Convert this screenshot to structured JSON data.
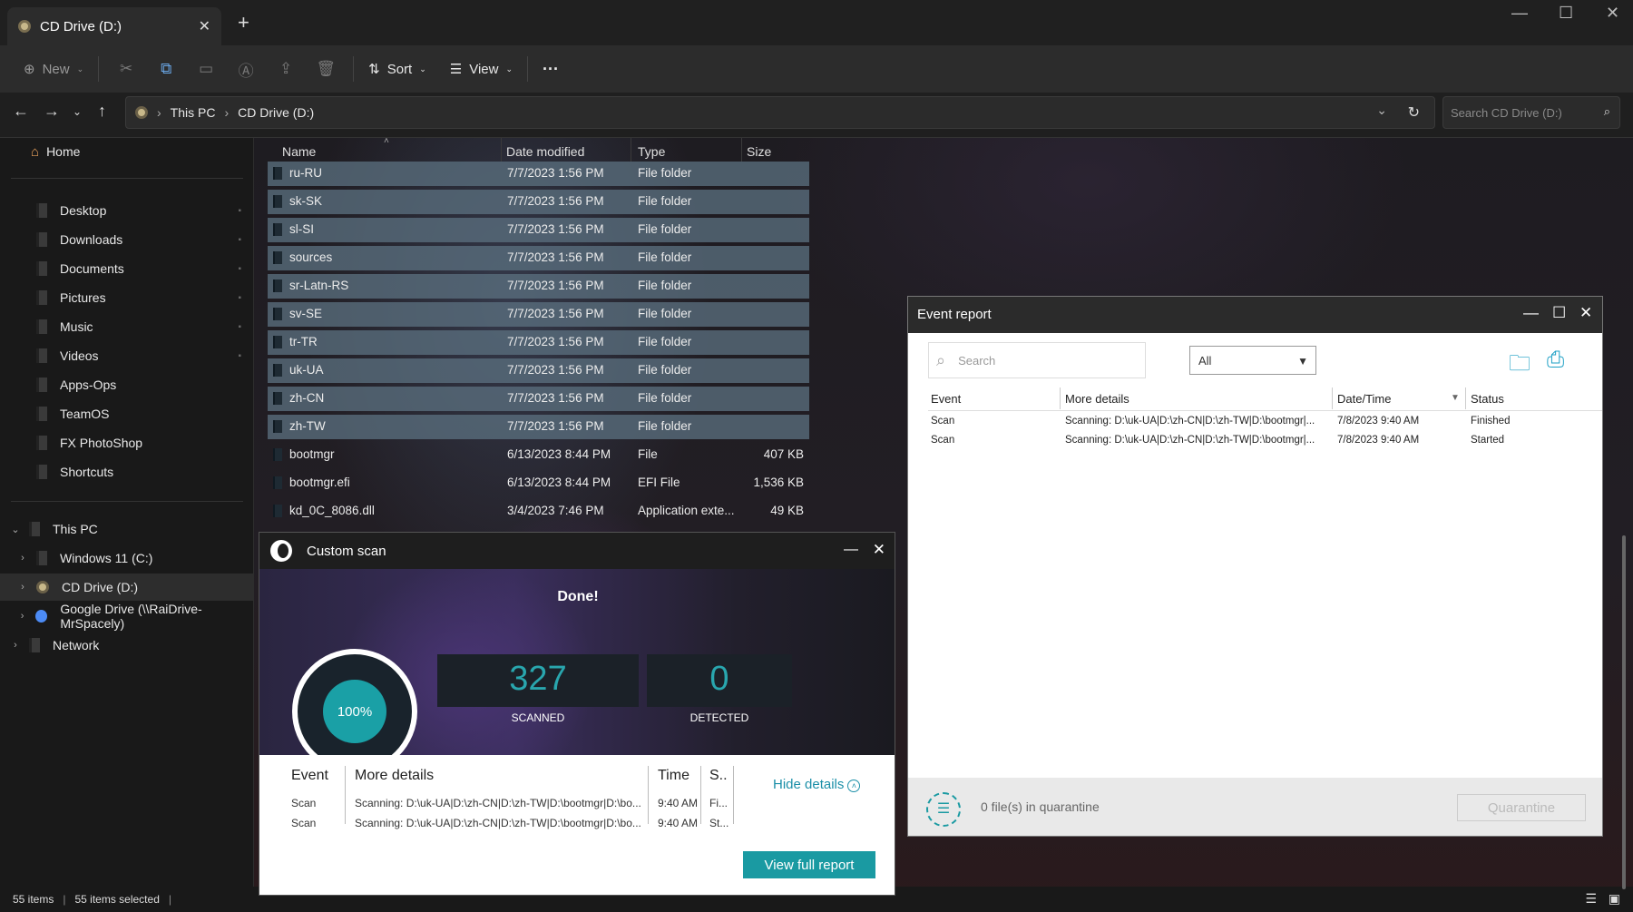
{
  "explorer": {
    "tab_title": "CD Drive (D:)",
    "toolbar": {
      "new_label": "New",
      "sort_label": "Sort",
      "view_label": "View",
      "more_label": "···"
    },
    "breadcrumb": [
      "This PC",
      "CD Drive (D:)"
    ],
    "search_placeholder": "Search CD Drive (D:)",
    "sidebar": {
      "home": "Home",
      "quick_access": [
        "Desktop",
        "Downloads",
        "Documents",
        "Pictures",
        "Music",
        "Videos",
        "Apps-Ops",
        "TeamOS",
        "FX PhotoShop",
        "Shortcuts"
      ],
      "this_pc": "This PC",
      "drives": [
        "Windows 11 (C:)",
        "CD Drive (D:)",
        "Google Drive (\\\\RaiDrive-MrSpacely)"
      ],
      "network": "Network"
    },
    "columns": {
      "name": "Name",
      "date": "Date modified",
      "type": "Type",
      "size": "Size"
    },
    "files": [
      {
        "name": "ru-RU",
        "date": "7/7/2023 1:56 PM",
        "type": "File folder",
        "size": ""
      },
      {
        "name": "sk-SK",
        "date": "7/7/2023 1:56 PM",
        "type": "File folder",
        "size": ""
      },
      {
        "name": "sl-SI",
        "date": "7/7/2023 1:56 PM",
        "type": "File folder",
        "size": ""
      },
      {
        "name": "sources",
        "date": "7/7/2023 1:56 PM",
        "type": "File folder",
        "size": ""
      },
      {
        "name": "sr-Latn-RS",
        "date": "7/7/2023 1:56 PM",
        "type": "File folder",
        "size": ""
      },
      {
        "name": "sv-SE",
        "date": "7/7/2023 1:56 PM",
        "type": "File folder",
        "size": ""
      },
      {
        "name": "tr-TR",
        "date": "7/7/2023 1:56 PM",
        "type": "File folder",
        "size": ""
      },
      {
        "name": "uk-UA",
        "date": "7/7/2023 1:56 PM",
        "type": "File folder",
        "size": ""
      },
      {
        "name": "zh-CN",
        "date": "7/7/2023 1:56 PM",
        "type": "File folder",
        "size": ""
      },
      {
        "name": "zh-TW",
        "date": "7/7/2023 1:56 PM",
        "type": "File folder",
        "size": ""
      },
      {
        "name": "bootmgr",
        "date": "6/13/2023 8:44 PM",
        "type": "File",
        "size": "407 KB"
      },
      {
        "name": "bootmgr.efi",
        "date": "6/13/2023 8:44 PM",
        "type": "EFI File",
        "size": "1,536 KB"
      },
      {
        "name": "kd_0C_8086.dll",
        "date": "3/4/2023 7:46 PM",
        "type": "Application exte...",
        "size": "49 KB"
      }
    ],
    "status": {
      "items": "55 items",
      "selected": "55 items selected"
    }
  },
  "custom_scan": {
    "title": "Custom scan",
    "headline": "Done!",
    "progress_label": "100%",
    "progress": 1.0,
    "scanned": {
      "value": "327",
      "label": "SCANNED"
    },
    "detected": {
      "value": "0",
      "label": "DETECTED"
    },
    "details": {
      "headers": {
        "event": "Event",
        "more": "More details",
        "time": "Time",
        "status": "S.."
      },
      "rows": [
        {
          "event": "Scan",
          "more": "Scanning: D:\\uk-UA|D:\\zh-CN|D:\\zh-TW|D:\\bootmgr|D:\\bo...",
          "time": "9:40 AM",
          "status": "Fi..."
        },
        {
          "event": "Scan",
          "more": "Scanning: D:\\uk-UA|D:\\zh-CN|D:\\zh-TW|D:\\bootmgr|D:\\bo...",
          "time": "9:40 AM",
          "status": "St..."
        }
      ]
    },
    "hide_details": "Hide details",
    "view_report": "View full report"
  },
  "event_report": {
    "title": "Event report",
    "search_placeholder": "Search",
    "filter_value": "All",
    "headers": {
      "event": "Event",
      "more": "More details",
      "datetime": "Date/Time",
      "status": "Status"
    },
    "rows": [
      {
        "event": "Scan",
        "more": "Scanning: D:\\uk-UA|D:\\zh-CN|D:\\zh-TW|D:\\bootmgr|...",
        "datetime": "7/8/2023 9:40 AM",
        "status": "Finished"
      },
      {
        "event": "Scan",
        "more": "Scanning: D:\\uk-UA|D:\\zh-CN|D:\\zh-TW|D:\\bootmgr|...",
        "datetime": "7/8/2023 9:40 AM",
        "status": "Started"
      }
    ],
    "quarantine_text": "0 file(s) in quarantine",
    "quarantine_button": "Quarantine"
  },
  "colors": {
    "accent": "#1a9aa2",
    "explorer_bg": "#202020"
  }
}
